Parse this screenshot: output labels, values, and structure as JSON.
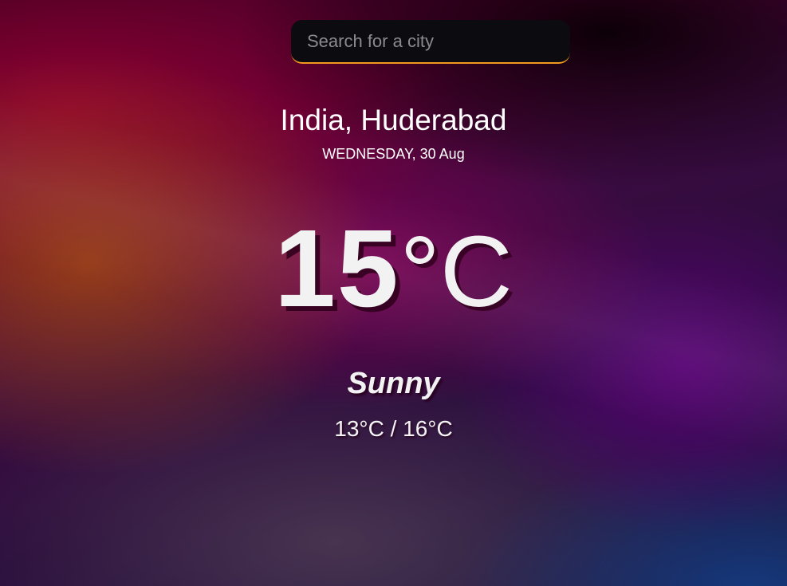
{
  "search": {
    "placeholder": "Search for a city",
    "accent_color": "#f29a1f"
  },
  "location": "India, Huderabad",
  "date": "WEDNESDAY, 30 Aug",
  "current": {
    "temperature": "15",
    "unit": "°C"
  },
  "condition": "Sunny",
  "range": "13°C / 16°C"
}
